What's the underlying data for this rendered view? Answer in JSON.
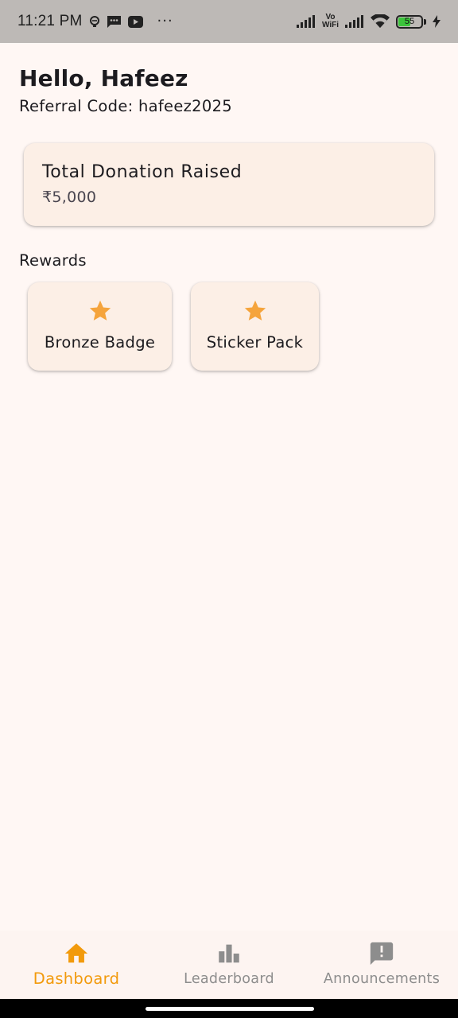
{
  "status_bar": {
    "time": "11:21 PM",
    "overflow": "···",
    "vo": "Vo",
    "wifi_label": "WiFi",
    "battery_level": "55",
    "battery_fraction": 0.55,
    "battery_color": "#3bc43b",
    "icons": [
      "alarm-icon",
      "message-icon",
      "youtube-icon",
      "signal-icon",
      "wifi-icon",
      "battery-icon",
      "charging-icon"
    ]
  },
  "greeting": "Hello, Hafeez",
  "referral": "Referral Code: hafeez2025",
  "donation": {
    "title": "Total Donation Raised",
    "amount": "₹5,000"
  },
  "rewards": {
    "heading": "Rewards",
    "items": [
      {
        "label": "Bronze Badge",
        "icon": "star-icon"
      },
      {
        "label": "Sticker Pack",
        "icon": "star-icon"
      }
    ]
  },
  "nav": {
    "items": [
      {
        "label": "Dashboard",
        "icon": "home-icon",
        "active": true
      },
      {
        "label": "Leaderboard",
        "icon": "leaderboard-icon",
        "active": false
      },
      {
        "label": "Announcements",
        "icon": "announcement-icon",
        "active": false
      }
    ]
  },
  "colors": {
    "accent": "#f29a0c",
    "star": "#f5a43c",
    "background": "#fff7f4",
    "card": "#fcefe6",
    "inactive": "#8d8d8d"
  }
}
